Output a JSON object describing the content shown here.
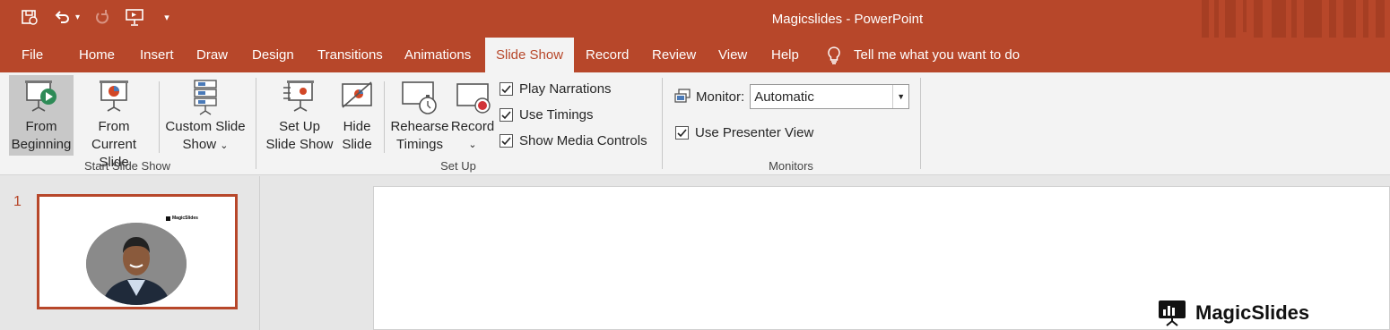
{
  "app": {
    "title": "Magicslides  -  PowerPoint"
  },
  "qat": {
    "icons": [
      "autosave-icon",
      "undo-icon",
      "redo-icon",
      "present-icon",
      "customize-qat-icon"
    ]
  },
  "tabs": [
    {
      "label": "File"
    },
    {
      "label": "Home"
    },
    {
      "label": "Insert"
    },
    {
      "label": "Draw"
    },
    {
      "label": "Design"
    },
    {
      "label": "Transitions"
    },
    {
      "label": "Animations"
    },
    {
      "label": "Slide Show"
    },
    {
      "label": "Record"
    },
    {
      "label": "Review"
    },
    {
      "label": "View"
    },
    {
      "label": "Help"
    }
  ],
  "active_tab": "Slide Show",
  "tell_me": "Tell me what you want to do",
  "ribbon": {
    "start": {
      "label": "Start Slide Show",
      "from_beginning": [
        "From",
        "Beginning"
      ],
      "from_current": [
        "From",
        "Current Slide"
      ],
      "custom": [
        "Custom Slide",
        "Show"
      ]
    },
    "setup": {
      "label": "Set Up",
      "setup_show": [
        "Set Up",
        "Slide Show"
      ],
      "hide_slide": [
        "Hide",
        "Slide"
      ],
      "rehearse": [
        "Rehearse",
        "Timings"
      ],
      "record": [
        "Record"
      ],
      "play_narrations": "Play Narrations",
      "use_timings": "Use Timings",
      "show_media_controls": "Show Media Controls"
    },
    "monitors": {
      "label": "Monitors",
      "monitor_label": "Monitor:",
      "monitor_value": "Automatic",
      "presenter_view": "Use Presenter View"
    }
  },
  "slides": {
    "current_number": "1",
    "brand": "MagicSlides",
    "thumb_brand": "MagicSlides"
  },
  "colors": {
    "accent": "#b7472a",
    "ribbon_bg": "#f3f3f3"
  }
}
